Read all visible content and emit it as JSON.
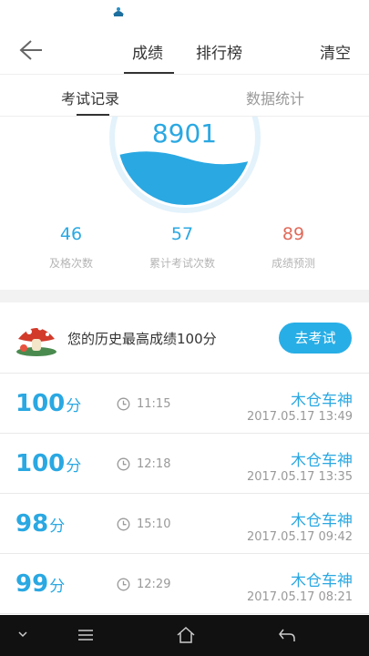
{
  "header": {
    "tabs": [
      {
        "label": "成绩"
      },
      {
        "label": "排行榜"
      }
    ],
    "clear_label": "清空"
  },
  "subtabs": [
    {
      "label": "考试记录"
    },
    {
      "label": "数据统计"
    }
  ],
  "gauge": {
    "value": "8901",
    "fill_fraction": 0.35
  },
  "stats": [
    {
      "value": "46",
      "label": "及格次数"
    },
    {
      "value": "57",
      "label": "累计考试次数"
    },
    {
      "value": "89",
      "label": "成绩预测"
    }
  ],
  "best": {
    "text": "您的历史最高成绩100分",
    "button_label": "去考试"
  },
  "records": [
    {
      "score": "100",
      "unit": "分",
      "duration": "11:15",
      "name": "木仓车神",
      "date": "2017.05.17  13:49"
    },
    {
      "score": "100",
      "unit": "分",
      "duration": "12:18",
      "name": "木仓车神",
      "date": "2017.05.17  13:35"
    },
    {
      "score": "98",
      "unit": "分",
      "duration": "15:10",
      "name": "木仓车神",
      "date": "2017.05.17  09:42"
    },
    {
      "score": "99",
      "unit": "分",
      "duration": "12:29",
      "name": "木仓车神",
      "date": "2017.05.17  08:21"
    }
  ],
  "colors": {
    "accent": "#2aa8e2",
    "prediction": "#e06a5a",
    "button": "#28aee6"
  },
  "icons": [
    "app-notification-icon",
    "back-arrow-icon",
    "mushroom-avatar-icon",
    "clock-icon",
    "chevron-down-icon",
    "menu-icon",
    "home-icon",
    "nav-back-icon"
  ]
}
